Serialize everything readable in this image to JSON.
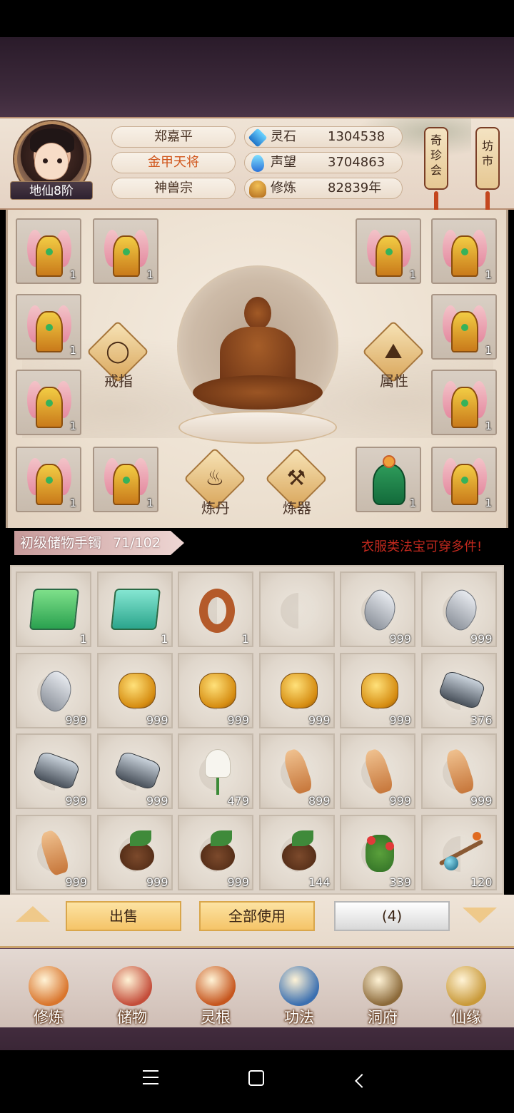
{
  "player": {
    "rank": "地仙8阶",
    "name": "郑嘉平",
    "title": "金甲天将",
    "sect": "神兽宗"
  },
  "stats": [
    {
      "label": "灵石",
      "value": "1304538",
      "icon": "spirit-stone-icon"
    },
    {
      "label": "声望",
      "value": "3704863",
      "icon": "reputation-icon"
    },
    {
      "label": "修炼",
      "value": "82839年",
      "icon": "cultivation-icon"
    }
  ],
  "shortcuts": {
    "treasure_fair": "奇珍会",
    "market": "坊市"
  },
  "equipment": {
    "slots": [
      {
        "item": "robe",
        "count": "1"
      },
      {
        "item": "robe",
        "count": "1"
      },
      {
        "item": "robe",
        "count": "1"
      },
      {
        "item": "robe",
        "count": "1"
      },
      {
        "item": "robe",
        "count": "1"
      },
      {
        "item": "robe",
        "count": "1"
      },
      {
        "item": "robe",
        "count": "1"
      },
      {
        "item": "robe",
        "count": "1"
      },
      {
        "item": "robe",
        "count": "1"
      },
      {
        "item": "robe",
        "count": "1"
      },
      {
        "item": "green-robe",
        "count": "1"
      },
      {
        "item": "robe",
        "count": "1"
      }
    ],
    "actions": {
      "ring": "戒指",
      "attributes": "属性",
      "alchemy": "炼丹",
      "forge": "炼器"
    }
  },
  "bag": {
    "name": "初级储物手镯",
    "capacity": "71/102",
    "tip": "衣服类法宝可穿多件!",
    "items": [
      {
        "icon": "green-book-icon",
        "count": "1"
      },
      {
        "icon": "teal-book-icon",
        "count": "1"
      },
      {
        "icon": "ring-icon",
        "count": "1"
      },
      {
        "icon": "empty-slot-icon",
        "count": ""
      },
      {
        "icon": "silver-stone-icon",
        "count": "999"
      },
      {
        "icon": "silver-stone-icon",
        "count": "999"
      },
      {
        "icon": "silver-stone-icon",
        "count": "999"
      },
      {
        "icon": "gold-ore-icon",
        "count": "999"
      },
      {
        "icon": "gold-ore-icon",
        "count": "999"
      },
      {
        "icon": "gold-ore-icon",
        "count": "999"
      },
      {
        "icon": "gold-ore-icon",
        "count": "999"
      },
      {
        "icon": "dark-ore-icon",
        "count": "376"
      },
      {
        "icon": "dark-ore-icon",
        "count": "999"
      },
      {
        "icon": "dark-ore-icon",
        "count": "999"
      },
      {
        "icon": "white-lily-icon",
        "count": "479"
      },
      {
        "icon": "ginseng-icon",
        "count": "899"
      },
      {
        "icon": "ginseng-icon",
        "count": "999"
      },
      {
        "icon": "ginseng-icon",
        "count": "999"
      },
      {
        "icon": "ginseng-icon",
        "count": "999"
      },
      {
        "icon": "root-leaf-icon",
        "count": "999"
      },
      {
        "icon": "root-leaf-icon",
        "count": "999"
      },
      {
        "icon": "root-leaf-icon",
        "count": "144"
      },
      {
        "icon": "berry-herb-icon",
        "count": "339"
      },
      {
        "icon": "branch-orb-icon",
        "count": "120"
      }
    ]
  },
  "actions": {
    "sell": "出售",
    "use_all": "全部使用",
    "selected": "(4)"
  },
  "nav": [
    {
      "label": "修炼",
      "icon": "cultivate-icon",
      "color": "#d9752c"
    },
    {
      "label": "储物",
      "icon": "storage-bag-icon",
      "color": "#c44d3a"
    },
    {
      "label": "灵根",
      "icon": "spirit-root-icon",
      "color": "#c6561e"
    },
    {
      "label": "功法",
      "icon": "skill-book-icon",
      "color": "#3a6fb0"
    },
    {
      "label": "洞府",
      "icon": "cave-house-icon",
      "color": "#8c6a3a"
    },
    {
      "label": "仙缘",
      "icon": "gourd-icon",
      "color": "#c99a3a"
    }
  ]
}
